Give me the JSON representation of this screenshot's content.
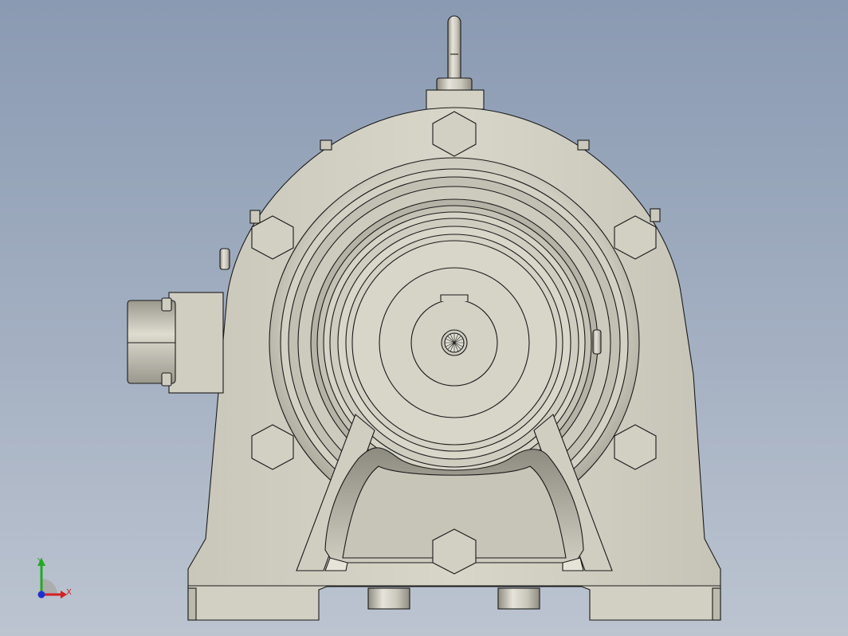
{
  "viewport": {
    "model": "gearbox-reducer-front-view",
    "background_top": "#8a9ab2",
    "background_bottom": "#bcc4d0",
    "part_color": "#d6d4c7",
    "part_shade": "#b8b6a9",
    "edge_color": "#1a1a1a"
  },
  "triad": {
    "x_label": "X",
    "y_label": "Y",
    "x_color": "#d42020",
    "y_color": "#22aa22",
    "z_color": "#2030d0"
  }
}
